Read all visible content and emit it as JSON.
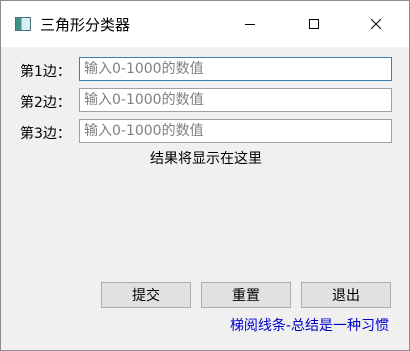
{
  "window": {
    "title": "三角形分类器",
    "controls": [
      "minimize-icon",
      "maximize-icon",
      "close-icon"
    ]
  },
  "form": {
    "rows": [
      {
        "label": "第1边：",
        "placeholder": "输入0-1000的数值",
        "value": ""
      },
      {
        "label": "第2边：",
        "placeholder": "输入0-1000的数值",
        "value": ""
      },
      {
        "label": "第3边：",
        "placeholder": "输入0-1000的数值",
        "value": ""
      }
    ],
    "result_text": "结果将显示在这里"
  },
  "buttons": {
    "submit": "提交",
    "reset": "重置",
    "exit": "退出"
  },
  "footer": {
    "text": "梯阅线条-总结是一种习惯",
    "color": "#0000c8"
  },
  "colors": {
    "focus_border": "#3c7fb1",
    "background": "#f0f0f0"
  }
}
